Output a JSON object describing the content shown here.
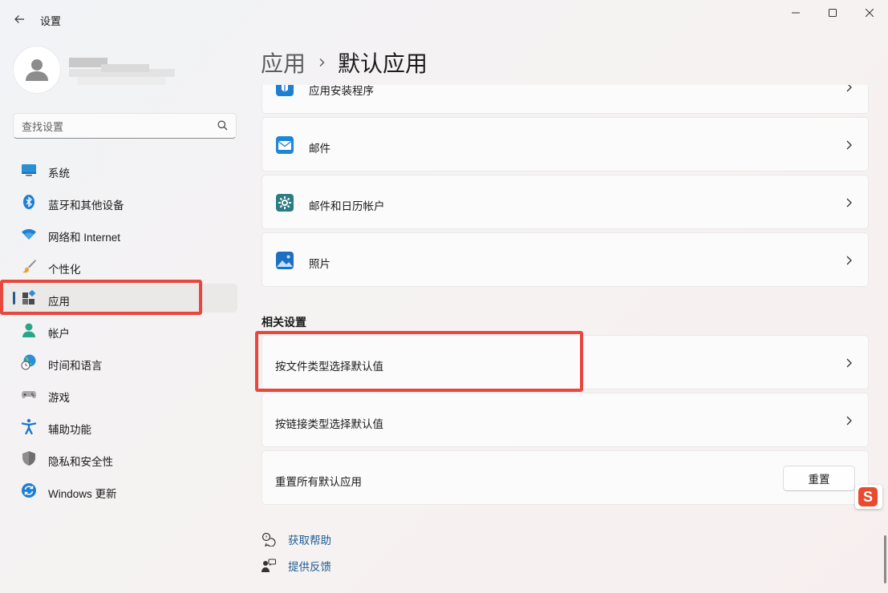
{
  "window": {
    "title": "设置"
  },
  "user": {
    "name_obscured": true
  },
  "search": {
    "placeholder": "查找设置"
  },
  "nav": {
    "items": [
      {
        "label": "系统",
        "icon": "system-icon"
      },
      {
        "label": "蓝牙和其他设备",
        "icon": "bluetooth-icon"
      },
      {
        "label": "网络和 Internet",
        "icon": "wifi-icon"
      },
      {
        "label": "个性化",
        "icon": "brush-icon"
      },
      {
        "label": "应用",
        "icon": "apps-icon",
        "active": true
      },
      {
        "label": "帐户",
        "icon": "account-icon"
      },
      {
        "label": "时间和语言",
        "icon": "time-language-icon"
      },
      {
        "label": "游戏",
        "icon": "gamepad-icon"
      },
      {
        "label": "辅助功能",
        "icon": "accessibility-icon"
      },
      {
        "label": "隐私和安全性",
        "icon": "shield-icon"
      },
      {
        "label": "Windows 更新",
        "icon": "update-icon"
      }
    ]
  },
  "breadcrumb": {
    "parent": "应用",
    "current": "默认应用"
  },
  "app_cards": [
    {
      "label": "应用安装程序",
      "icon": "app-installer-icon"
    },
    {
      "label": "邮件",
      "icon": "mail-icon"
    },
    {
      "label": "邮件和日历帐户",
      "icon": "mail-calendar-settings-icon"
    },
    {
      "label": "照片",
      "icon": "photos-icon"
    }
  ],
  "related": {
    "title": "相关设置",
    "items": [
      {
        "label": "按文件类型选择默认值"
      },
      {
        "label": "按链接类型选择默认值"
      }
    ],
    "reset": {
      "label": "重置所有默认应用",
      "button": "重置"
    }
  },
  "help": {
    "get_help": "获取帮助",
    "feedback": "提供反馈"
  },
  "ime": {
    "glyph": "S"
  },
  "colors": {
    "accent": "#1c5d8c",
    "highlight_box": "#e8473e",
    "link": "#1d5e94"
  }
}
